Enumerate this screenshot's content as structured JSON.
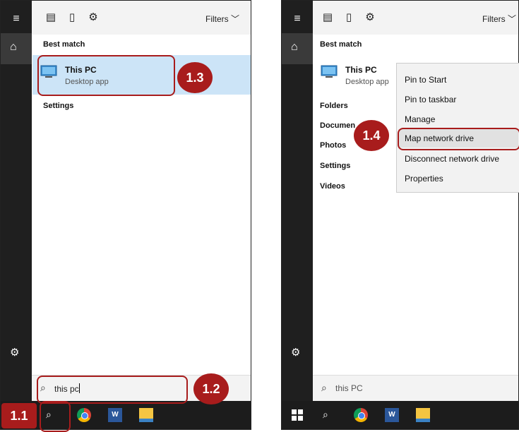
{
  "left": {
    "filters_label": "Filters",
    "best_match_heading": "Best match",
    "result_title": "This PC",
    "result_subtitle": "Desktop app",
    "settings_heading": "Settings",
    "search_text": "this pc"
  },
  "right": {
    "filters_label": "Filters",
    "best_match_heading": "Best match",
    "result_title": "This PC",
    "result_subtitle": "Desktop app",
    "categories": [
      "Folders",
      "Documen",
      "Photos",
      "Settings",
      "Videos"
    ],
    "context_menu": [
      "Pin to Start",
      "Pin to taskbar",
      "Manage",
      "Map network drive",
      "Disconnect network drive",
      "Properties"
    ],
    "search_text": "this PC"
  },
  "callouts": {
    "c11": "1.1",
    "c12": "1.2",
    "c13": "1.3",
    "c14": "1.4"
  },
  "icons": {
    "menu": "hamburger-icon",
    "home": "home-icon",
    "settings": "gear-icon",
    "search": "search-icon",
    "chrome": "chrome-icon",
    "word": "word-icon",
    "explorer": "file-explorer-icon",
    "windows": "windows-logo-icon"
  },
  "colors": {
    "callout": "#a81c1c",
    "highlight": "#cce4f7",
    "sidebar": "#1f1f1f",
    "taskbar": "#1c1c1c"
  },
  "word_icon_glyph": "W"
}
